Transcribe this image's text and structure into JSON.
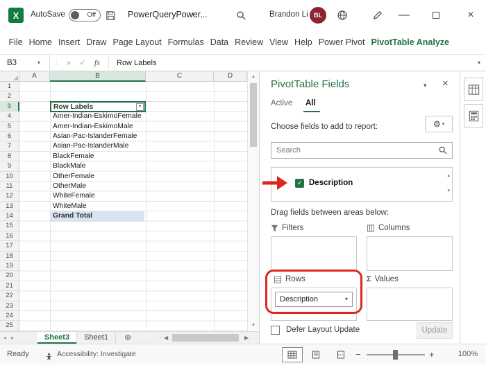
{
  "icons": {
    "chevron_down": "▾",
    "chevron_up": "▴",
    "arrow_left": "◀",
    "arrow_right": "▶",
    "tri_left": "◂",
    "tri_right": "▸",
    "close": "×",
    "minimize": "—",
    "check": "✓",
    "cancel": "×",
    "dots": "⋮",
    "fx": "fx",
    "gear": "⚙",
    "sigma": "Σ",
    "add_sheet": "⊕",
    "plus": "+",
    "minus": "−",
    "logo_letter": "X"
  },
  "titlebar": {
    "autosave_label": "AutoSave",
    "autosave_state": "Off",
    "document_name": "PowerQueryPower...",
    "user_name": "Brandon Li",
    "user_initials": "BL"
  },
  "ribbon": {
    "tabs": [
      "File",
      "Home",
      "Insert",
      "Draw",
      "Page Layout",
      "Formulas",
      "Data",
      "Review",
      "View",
      "Help",
      "Power Pivot",
      "PivotTable Analyze"
    ]
  },
  "formula_bar": {
    "name_box": "B3",
    "value": "Row Labels"
  },
  "grid": {
    "columns": [
      "A",
      "B",
      "C",
      "D"
    ],
    "row_numbers": [
      "1",
      "2",
      "3",
      "4",
      "5",
      "6",
      "7",
      "8",
      "9",
      "10",
      "11",
      "12",
      "13",
      "14",
      "15",
      "16",
      "17",
      "18",
      "19",
      "20",
      "21",
      "22",
      "23",
      "24",
      "25"
    ],
    "header_cell": "Row Labels",
    "values": [
      "Amer-Indian-EskimoFemale",
      "Amer-Indian-EskimoMale",
      "Asian-Pac-IslanderFemale",
      "Asian-Pac-IslanderMale",
      "BlackFemale",
      "BlackMale",
      "OtherFemale",
      "OtherMale",
      "WhiteFemale",
      "WhiteMale"
    ],
    "grand_total": "Grand Total"
  },
  "sheet_bar": {
    "tabs": [
      "Sheet3",
      "Sheet1"
    ]
  },
  "pane": {
    "title": "PivotTable Fields",
    "tabs": [
      "Active",
      "All"
    ],
    "choose_label": "Choose fields to add to report:",
    "search_placeholder": "Search",
    "fields": [
      "Description"
    ],
    "drag_label": "Drag fields between areas below:",
    "areas": {
      "filters": "Filters",
      "columns": "Columns",
      "rows": "Rows",
      "values": "Values"
    },
    "rows_area_value": "Description",
    "defer_label": "Defer Layout Update",
    "update_label": "Update"
  },
  "status_bar": {
    "ready": "Ready",
    "accessibility": "Accessibility: Investigate",
    "zoom": "100%"
  }
}
